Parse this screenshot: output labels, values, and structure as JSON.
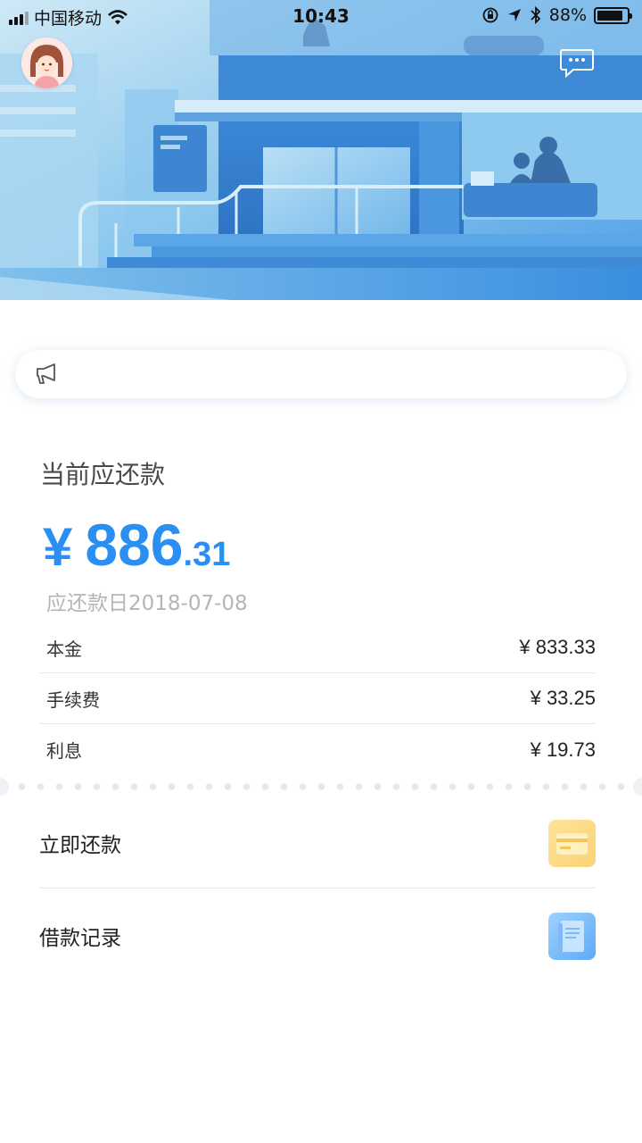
{
  "status_bar": {
    "carrier": "中国移动",
    "time": "10:43",
    "battery": "88%",
    "battery_level": 0.88
  },
  "header": {
    "avatar_icon": "user-avatar",
    "message_icon": "chat-bubble-icon"
  },
  "notice": {
    "icon": "megaphone-icon",
    "text": ""
  },
  "summary": {
    "title": "当前应还款",
    "currency": "¥",
    "amount_int": "886",
    "amount_dec": ".31",
    "due_date": "应还款日2018-07-08",
    "accent_color": "#2a8ff0"
  },
  "details": [
    {
      "label": "本金",
      "value": "¥ 833.33"
    },
    {
      "label": "手续费",
      "value": "¥ 33.25"
    },
    {
      "label": "利息",
      "value": "¥ 19.73"
    }
  ],
  "actions": [
    {
      "label": "立即还款",
      "icon": "card-icon"
    },
    {
      "label": "借款记录",
      "icon": "document-icon"
    }
  ]
}
